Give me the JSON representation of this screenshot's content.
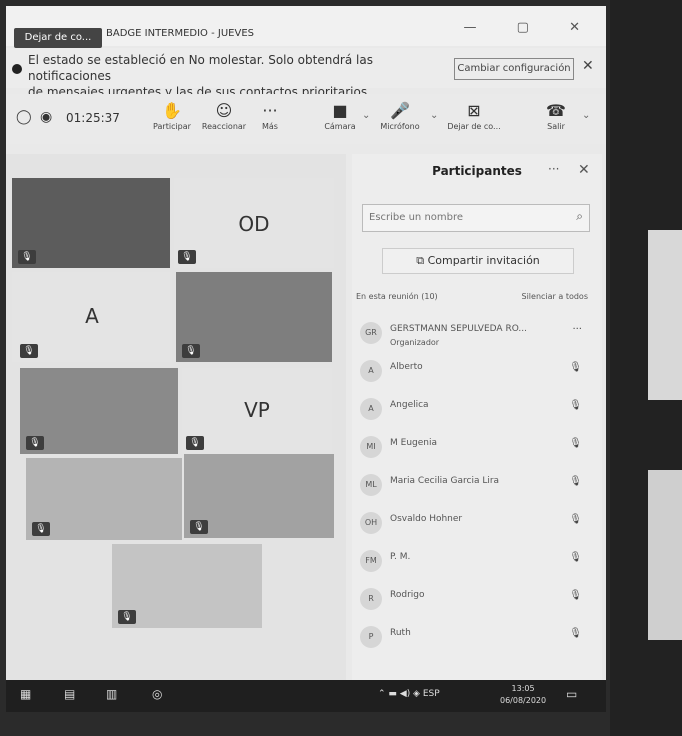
{
  "window": {
    "leave_button": "Dejar de co...",
    "title": "BADGE INTERMEDIO - JUEVES",
    "controls": "— ▢ ✕"
  },
  "banner": {
    "text_line1": "El estado se estableció en No molestar. Solo obtendrá las notificaciones",
    "text_line2": "de mensajes urgentes y las de sus contactos prioritarios.",
    "config_button": "Cambiar configuración",
    "close": "✕"
  },
  "toolbar": {
    "timer": "01:25:37",
    "items": [
      {
        "label": "Participar",
        "icon": "raise-hand-icon",
        "glyph": "✋"
      },
      {
        "label": "Reaccionar",
        "icon": "smiley-icon",
        "glyph": "☺"
      },
      {
        "label": "Más",
        "icon": "more-icon",
        "glyph": "···"
      },
      {
        "label": "Cámara",
        "icon": "camera-icon",
        "glyph": "■"
      },
      {
        "label": "Micrófono",
        "icon": "microphone-icon",
        "glyph": "🎤"
      },
      {
        "label": "Dejar de co...",
        "icon": "stop-share-icon",
        "glyph": "⊠"
      },
      {
        "label": "Salir",
        "icon": "phone-icon",
        "glyph": "☎"
      }
    ]
  },
  "gallery": {
    "tiles": [
      {
        "initials": ""
      },
      {
        "initials": "OD"
      },
      {
        "initials": "A"
      },
      {
        "initials": ""
      },
      {
        "initials": ""
      },
      {
        "initials": "VP"
      },
      {
        "initials": ""
      },
      {
        "initials": ""
      },
      {
        "initials": ""
      }
    ]
  },
  "participants": {
    "title": "Participantes",
    "more": "···",
    "close": "✕",
    "search_placeholder": "Escribe un nombre",
    "share_label": "Compartir invitación",
    "section_label": "En esta reunión (10)",
    "mute_all": "Silenciar a todos",
    "list": [
      {
        "initials": "GR",
        "name": "GERSTMANN SEPULVEDA RO...",
        "role": "Organizador"
      },
      {
        "initials": "A",
        "name": "Alberto",
        "role": ""
      },
      {
        "initials": "A",
        "name": "Angelica",
        "role": ""
      },
      {
        "initials": "MI",
        "name": "M Eugenia",
        "role": ""
      },
      {
        "initials": "ML",
        "name": "Maria Cecilia Garcia Lira",
        "role": ""
      },
      {
        "initials": "OH",
        "name": "Osvaldo Hohner",
        "role": ""
      },
      {
        "initials": "FM",
        "name": "P. M.",
        "role": ""
      },
      {
        "initials": "R",
        "name": "Rodrigo",
        "role": ""
      },
      {
        "initials": "P",
        "name": "Ruth",
        "role": ""
      }
    ]
  },
  "taskbar": {
    "tray_lang": "ESP",
    "time": "13:05",
    "date": "06/08/2020"
  }
}
